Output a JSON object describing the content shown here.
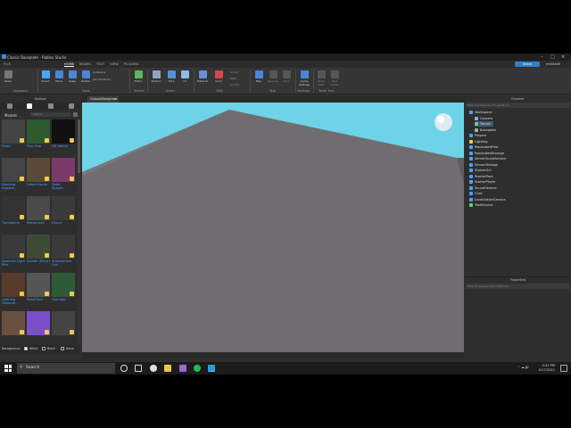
{
  "window": {
    "title": "Classic Baseplate - Roblox Studio",
    "share_label": "Share",
    "user_label": "mW0edR"
  },
  "menu": [
    "FILE",
    "HOME",
    "MODEL",
    "TEST",
    "VIEW",
    "PLUGINS"
  ],
  "ribbon": {
    "buttons": [
      "Paste",
      "Select",
      "Move",
      "Scale",
      "Rotate",
      "Editor",
      "Toolbox",
      "Part",
      "UI",
      "Material",
      "Color",
      "Group",
      "Lock",
      "Anchor",
      "Play",
      "Resume",
      "Stop",
      "Game Settings",
      "Team Test",
      "Exit Game"
    ],
    "collision": [
      "Collisions",
      "Join Surfaces"
    ],
    "groups": [
      "Clipboard",
      "Tools",
      "Terrain",
      "Insert",
      "Edit",
      "Test",
      "Settings",
      "Team Test"
    ]
  },
  "toolbox": {
    "title": "Toolbox",
    "models_label": "Models",
    "search_placeholder": "Search",
    "items": [
      {
        "label": "Pistol",
        "color": "#444444"
      },
      {
        "label": "Pine Tree",
        "color": "#2f5a2f"
      },
      {
        "label": "HD Admin",
        "color": "#111111"
      },
      {
        "label": "Drooling Zombie...",
        "color": "#454545"
      },
      {
        "label": "Urban House",
        "color": "#5a4a3a"
      },
      {
        "label": "Team Spawn...",
        "color": "#7a3a6a"
      },
      {
        "label": "Trampoline",
        "color": "#333333"
      },
      {
        "label": "Motorcycle",
        "color": "#4a4a4a"
      },
      {
        "label": "Firepit",
        "color": "#3a3a3a"
      },
      {
        "label": "Dynamic Light Pole",
        "color": "#3a3a3a"
      },
      {
        "label": "Soldier (R6 or)",
        "color": "#3d4a35"
      },
      {
        "label": "Submachine Gun",
        "color": "#3a3a3a"
      },
      {
        "label": "Opening Treasure...",
        "color": "#5a3a2a"
      },
      {
        "label": "Road Pack",
        "color": "#555555"
      },
      {
        "label": "Grenade",
        "color": "#2f5a3a"
      },
      {
        "label": "",
        "color": "#6a5040"
      },
      {
        "label": "",
        "color": "#7a50c8"
      },
      {
        "label": "",
        "color": "#444444"
      }
    ],
    "background_label": "Background:",
    "bg_options": [
      "White",
      "Black",
      "None"
    ]
  },
  "document_tab": "ClassicBaseplate",
  "explorer": {
    "title": "Explorer",
    "filter_placeholder": "Filter workspace (Ctrl+Shift+X)",
    "nodes": [
      {
        "label": "Workspace",
        "color": "#4aa3ff",
        "indent": 0
      },
      {
        "label": "Camera",
        "color": "#8fb3d9",
        "indent": 1
      },
      {
        "label": "Terrain",
        "color": "#7acc7a",
        "indent": 1,
        "selected": true
      },
      {
        "label": "Baseplate",
        "color": "#aaaaaa",
        "indent": 1
      },
      {
        "label": "Players",
        "color": "#4aa3ff",
        "indent": 0
      },
      {
        "label": "Lighting",
        "color": "#f2d24c",
        "indent": 0
      },
      {
        "label": "ReplicatedFirst",
        "color": "#4aa3ff",
        "indent": 0
      },
      {
        "label": "ReplicatedStorage",
        "color": "#4aa3ff",
        "indent": 0
      },
      {
        "label": "ServerScriptService",
        "color": "#4aa3ff",
        "indent": 0
      },
      {
        "label": "ServerStorage",
        "color": "#4aa3ff",
        "indent": 0
      },
      {
        "label": "StarterGui",
        "color": "#4aa3ff",
        "indent": 0
      },
      {
        "label": "StarterPack",
        "color": "#4aa3ff",
        "indent": 0
      },
      {
        "label": "StarterPlayer",
        "color": "#4aa3ff",
        "indent": 0
      },
      {
        "label": "SoundService",
        "color": "#4aa3ff",
        "indent": 0
      },
      {
        "label": "Chat",
        "color": "#4aa3ff",
        "indent": 0
      },
      {
        "label": "LocalizationService",
        "color": "#4aa3ff",
        "indent": 0
      },
      {
        "label": "TestService",
        "color": "#6ad06a",
        "indent": 0
      }
    ]
  },
  "properties": {
    "title": "Properties",
    "filter_placeholder": "Filter Properties (Ctrl+Shift+P)"
  },
  "taskbar": {
    "search_label": "Search",
    "time": "4:41 PM",
    "date": "5/17/2021"
  }
}
